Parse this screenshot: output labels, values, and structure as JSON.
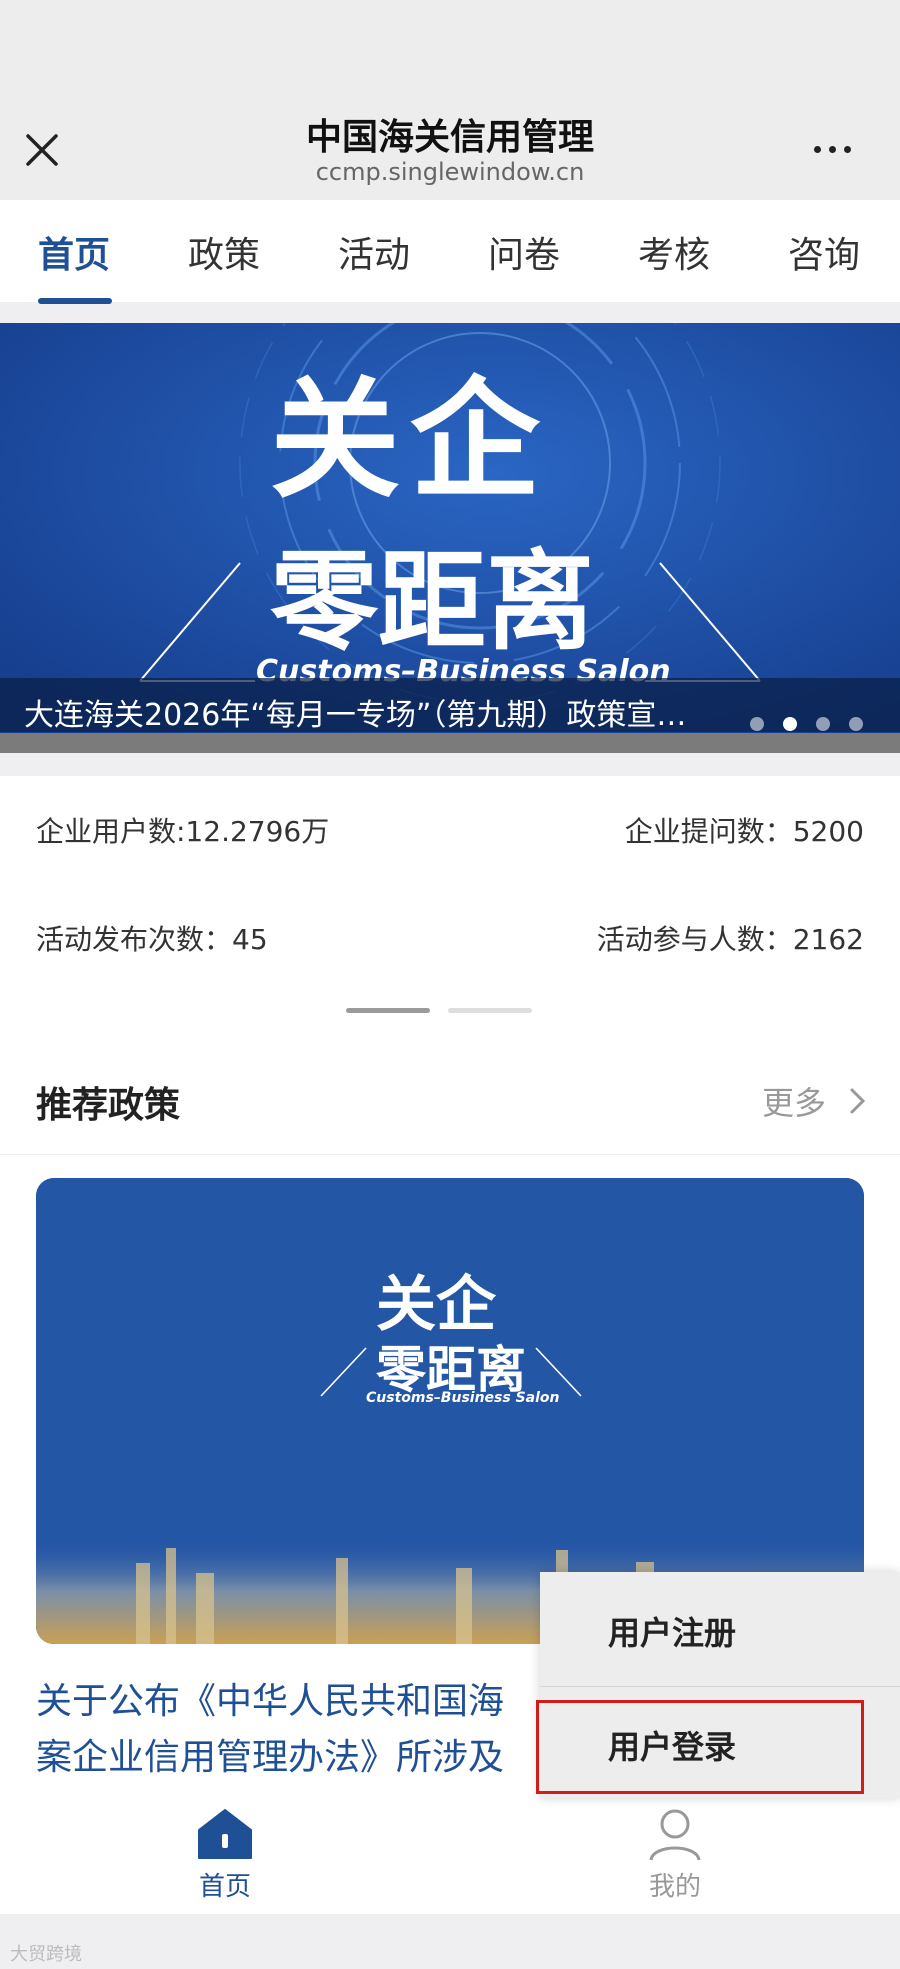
{
  "header": {
    "title": "中国海关信用管理",
    "domain": "ccmp.singlewindow.cn"
  },
  "tabs": [
    {
      "label": "首页",
      "active": true
    },
    {
      "label": "政策"
    },
    {
      "label": "活动"
    },
    {
      "label": "问卷"
    },
    {
      "label": "考核"
    },
    {
      "label": "咨询"
    }
  ],
  "banner": {
    "headline_top": "关企",
    "headline_main": "零距离",
    "subtitle": "Customs–Business Salon",
    "caption": "大连海关2026年“每月一专场”（第九期）政策宣…",
    "slide_count": 4,
    "active_slide": 2
  },
  "stats": {
    "enterprise_users": "企业用户数:12.2796万",
    "enterprise_questions": "企业提问数：5200",
    "activities_published": "活动发布次数：45",
    "activity_participants": "活动参与人数：2162"
  },
  "recommended": {
    "title": "推荐政策",
    "more_label": "更多",
    "card_headline_top": "关企",
    "card_headline_main": "零距离",
    "card_subtitle": "Customs–Business Salon",
    "policy_title_line1": "关于公布《中华人民共和国海",
    "policy_title_line2": "案企业信用管理办法》所涉及"
  },
  "popup": {
    "register_label": "用户注册",
    "login_label": "用户登录"
  },
  "bottom_nav": {
    "home_label": "首页",
    "mine_label": "我的"
  },
  "watermark": "大贸跨境",
  "colors": {
    "accent": "#1f4f94",
    "banner_blue": "#1e4fa8",
    "highlight_red": "#d21b1b"
  }
}
